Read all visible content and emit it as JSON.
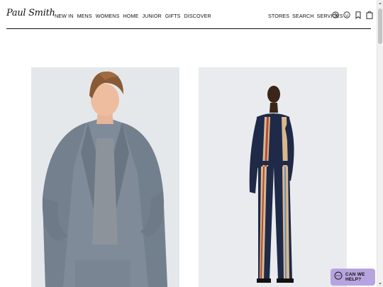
{
  "brand": {
    "logo_text": "Paul Smith"
  },
  "nav": {
    "items": [
      "NEW IN",
      "MENS",
      "WOMENS",
      "HOME",
      "JUNIOR",
      "GIFTS",
      "DISCOVER"
    ]
  },
  "utility": {
    "items": [
      "STORES",
      "SEARCH",
      "SERVICES"
    ]
  },
  "header_icons": [
    "currency-icon",
    "account-icon",
    "wishlist-icon",
    "bag-icon"
  ],
  "currency_symbol": "$",
  "cards": [
    {
      "name": "mens-suit-image",
      "description_icon": "man-in-grey-suit"
    },
    {
      "name": "womens-stripe-image",
      "description_icon": "woman-in-striped-outfit"
    }
  ],
  "help": {
    "label": "CAN WE HELP?"
  },
  "colors": {
    "accent": "#b7a4de",
    "rule": "#111111",
    "card_bg_left": "#e5e8eb",
    "card_bg_right": "#e9ebee"
  }
}
